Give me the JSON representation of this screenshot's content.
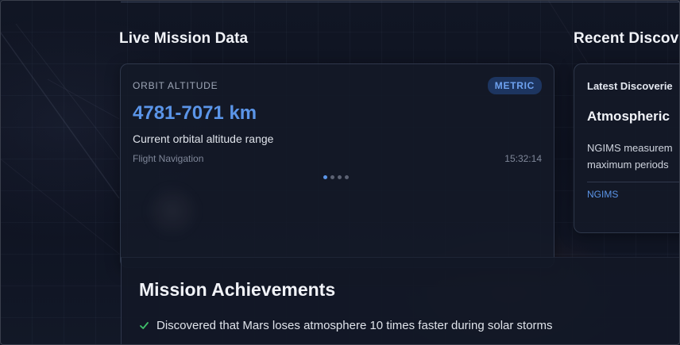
{
  "sections": {
    "live_title": "Live Mission Data",
    "recent_title": "Recent Discove"
  },
  "mission_card": {
    "label": "ORBIT ALTITUDE",
    "badge": "METRIC",
    "value": "4781-7071 km",
    "description": "Current orbital altitude range",
    "source": "Flight Navigation",
    "time": "15:32:14",
    "carousel": {
      "count": 4,
      "active_index": 0
    }
  },
  "discovery_card": {
    "label": "Latest Discoverie",
    "heading": "Atmospheric",
    "text_line1": "NGIMS measurem",
    "text_line2": "maximum periods",
    "tag": "NGIMS"
  },
  "achievements": {
    "title": "Mission Achievements",
    "items": [
      {
        "icon": "check-icon",
        "text": "Discovered that Mars loses atmosphere 10 times faster during solar storms"
      }
    ]
  },
  "colors": {
    "accent": "#5b95e8",
    "badge_bg": "#1d3560",
    "check": "#3fbf6a",
    "background": "#0d111d"
  }
}
